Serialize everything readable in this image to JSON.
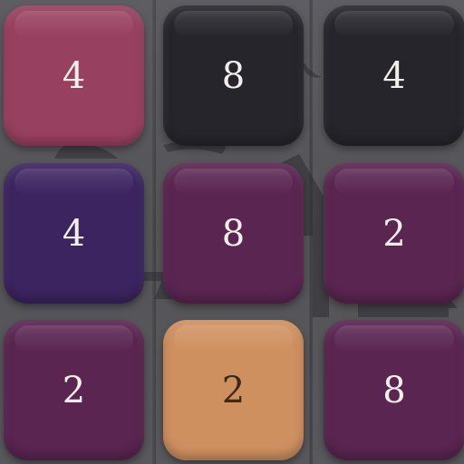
{
  "grid": {
    "rows": [
      [
        {
          "value": "4",
          "color": "#98405f"
        },
        {
          "value": "8",
          "color": "#25252b"
        },
        {
          "value": "4",
          "color": "#25252b"
        }
      ],
      [
        {
          "value": "4",
          "color": "#3c2460"
        },
        {
          "value": "8",
          "color": "#5a2551"
        },
        {
          "value": "2",
          "color": "#5a2551"
        }
      ],
      [
        {
          "value": "2",
          "color": "#5a2551"
        },
        {
          "value": "2",
          "color": "#cf9060"
        },
        {
          "value": "8",
          "color": "#5a2551"
        }
      ]
    ]
  },
  "colors": {
    "background": "#4a4a4e",
    "text_dark_tile": "#f2eee9",
    "text_light_tile": "#3b2a18"
  }
}
